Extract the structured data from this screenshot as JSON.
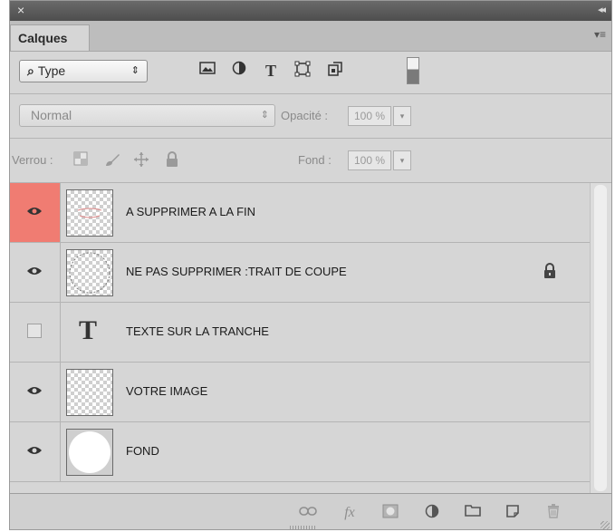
{
  "panel": {
    "close_glyph": "×",
    "collapse_glyph": "◂◂",
    "tab_label": "Calques",
    "menu_glyph": "▾≡"
  },
  "filter": {
    "search_glyph": "⌕",
    "kind_value": "Type",
    "kind_arrows": "⇕",
    "icons": [
      "image-filter-icon",
      "adjustment-filter-icon",
      "type-filter-icon",
      "shape-filter-icon",
      "smart-object-filter-icon"
    ]
  },
  "blend": {
    "mode_value": "Normal",
    "mode_arrows": "⇕",
    "opacity_label": "Opacité :",
    "opacity_value": "100 %",
    "dropdown_glyph": "▾"
  },
  "lock": {
    "label": "Verrou :",
    "fill_label": "Fond :",
    "fill_value": "100 %",
    "dropdown_glyph": "▾",
    "icons": [
      "lock-transparent-pixels-icon",
      "lock-image-pixels-icon",
      "lock-position-icon",
      "lock-all-icon"
    ]
  },
  "layers": [
    {
      "name": "A SUPPRIMER A LA FIN",
      "visible": true,
      "selected": true,
      "thumb": "transparent",
      "locked": false
    },
    {
      "name": "NE PAS SUPPRIMER :TRAIT DE COUPE",
      "visible": true,
      "selected": false,
      "thumb": "transparent",
      "locked": true
    },
    {
      "name": "TEXTE SUR LA TRANCHE",
      "visible": false,
      "selected": false,
      "thumb": "type",
      "locked": false
    },
    {
      "name": "VOTRE IMAGE",
      "visible": true,
      "selected": false,
      "thumb": "transparent",
      "locked": false
    },
    {
      "name": "FOND",
      "visible": true,
      "selected": false,
      "thumb": "white",
      "locked": false
    }
  ],
  "type_thumb_glyph": "T",
  "footer": {
    "icons": [
      "link-layers-icon",
      "fx-icon",
      "add-mask-icon",
      "new-adjustment-icon",
      "new-group-icon",
      "new-layer-icon",
      "delete-layer-icon"
    ],
    "fx_label": "fx"
  },
  "colors": {
    "selected_visibility": "#f07c72",
    "panel_bg": "#d6d6d6"
  }
}
